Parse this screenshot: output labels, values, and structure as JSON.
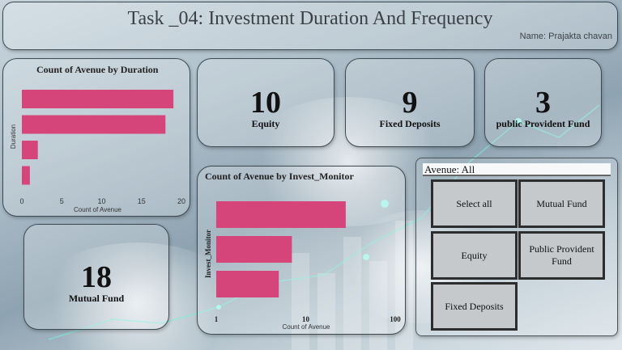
{
  "header": {
    "title": "Task _04: Investment Duration And Frequency",
    "author": "Name: Prajakta chavan"
  },
  "kpis": {
    "equity": {
      "value": "10",
      "label": "Equity"
    },
    "fixed_deposits": {
      "value": "9",
      "label": "Fixed Deposits"
    },
    "ppf": {
      "value": "3",
      "label": "public Provident Fund"
    },
    "mutual_fund": {
      "value": "18",
      "label": "Mutual Fund"
    }
  },
  "colors": {
    "bar": "#d6457a",
    "text": "#111111",
    "tile": "#c5c9cc"
  },
  "chart_data": [
    {
      "type": "bar",
      "orientation": "horizontal",
      "title": "Count of Avenue by Duration",
      "xlabel": "Count of Avenue",
      "ylabel": "Duration",
      "values": [
        19,
        18,
        2,
        1
      ],
      "xlim": [
        0,
        20
      ],
      "xticks": [
        "0",
        "5",
        "10",
        "15",
        "20"
      ],
      "grid": false
    },
    {
      "type": "bar",
      "orientation": "horizontal",
      "title": "Count of Avenue by Invest_Monitor",
      "xlabel": "Count of Avenue",
      "ylabel": "Invest_Monitor",
      "scale": "log",
      "values": [
        28,
        7,
        5
      ],
      "xlim": [
        1,
        100
      ],
      "xticks": [
        "1",
        "10",
        "100"
      ],
      "grid": false
    }
  ],
  "slicer": {
    "header": "Avenue: All",
    "options": [
      "Select all",
      "Mutual Fund",
      "Equity",
      "Public Provident Fund",
      "Fixed Deposits"
    ]
  }
}
